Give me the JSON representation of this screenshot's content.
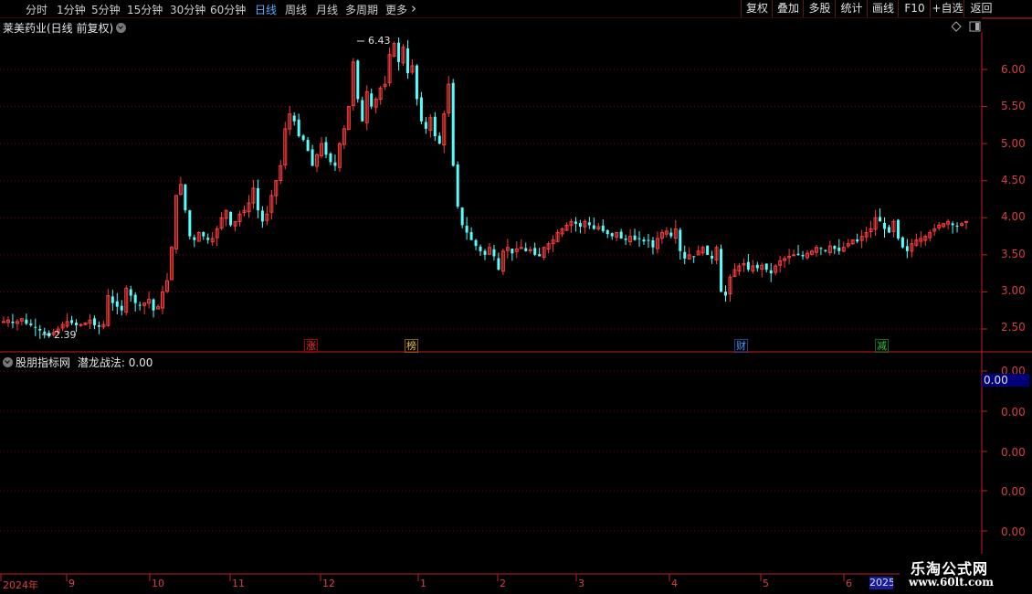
{
  "toolbar": {
    "periods": [
      "分时",
      "1分钟",
      "5分钟",
      "15分钟",
      "30分钟",
      "60分钟",
      "日线",
      "周线",
      "月线",
      "多周期",
      "更多"
    ],
    "active_period": "日线",
    "buttons": [
      "复权",
      "叠加",
      "多股",
      "统计",
      "画线",
      "F10",
      "+自选",
      "返回"
    ]
  },
  "stock": {
    "title": "莱美药业(日线 前复权)"
  },
  "price_axis": {
    "labels": [
      "6.00",
      "5.50",
      "5.00",
      "4.50",
      "4.00",
      "3.50",
      "3.00",
      "2.50"
    ]
  },
  "annotations": {
    "high": "6.43",
    "low": "2.39"
  },
  "markers": [
    {
      "text": "涨",
      "color": "#ff3030"
    },
    {
      "text": "榜",
      "color": "#e8c030"
    },
    {
      "text": "财",
      "color": "#40a0ff"
    },
    {
      "text": "减",
      "color": "#30d030"
    }
  ],
  "indicator": {
    "name": "股朋指标网",
    "line_label": "潜龙战法: 0.00",
    "axis_labels": [
      "0.00",
      "0.00",
      "0.00",
      "0.00",
      "0.00",
      "0.00"
    ],
    "current_value": "0.00"
  },
  "time_axis": {
    "labels": [
      "2024年",
      "9",
      "10",
      "11",
      "12",
      "1",
      "2",
      "3",
      "4",
      "5",
      "6"
    ],
    "highlight_label": "2025"
  },
  "watermark": {
    "line1": "乐淘公式网",
    "line2": "www.60lt.com"
  },
  "colors": {
    "up": "#ff3c3c",
    "down": "#54ffff",
    "grid": "#7a0000",
    "axis": "#c02020"
  },
  "chart_data": {
    "type": "candlestick",
    "title": "莱美药业(日线 前复权)",
    "ylim": [
      2.3,
      6.6
    ],
    "high": 6.43,
    "low": 2.39,
    "closes": [
      2.6,
      2.62,
      2.58,
      2.6,
      2.64,
      2.57,
      2.55,
      2.52,
      2.48,
      2.44,
      2.4,
      2.45,
      2.5,
      2.56,
      2.6,
      2.58,
      2.55,
      2.56,
      2.58,
      2.62,
      2.55,
      2.53,
      2.56,
      2.95,
      2.85,
      2.8,
      2.75,
      3.05,
      2.95,
      2.85,
      2.82,
      2.85,
      2.9,
      2.75,
      2.8,
      3.0,
      3.15,
      3.6,
      4.3,
      4.45,
      4.1,
      3.75,
      3.7,
      3.8,
      3.75,
      3.7,
      3.72,
      3.85,
      4.0,
      4.1,
      3.9,
      3.95,
      4.05,
      4.1,
      4.2,
      4.4,
      4.1,
      3.95,
      4.05,
      4.3,
      4.5,
      4.7,
      5.2,
      5.4,
      5.3,
      5.1,
      5.05,
      4.9,
      4.7,
      4.85,
      5.0,
      4.85,
      4.75,
      4.7,
      5.0,
      5.2,
      5.5,
      6.1,
      5.6,
      5.3,
      5.7,
      5.5,
      5.6,
      5.75,
      5.8,
      6.2,
      6.35,
      6.1,
      6.3,
      5.95,
      6.05,
      5.6,
      5.3,
      5.2,
      5.35,
      5.1,
      5.0,
      5.4,
      5.8,
      4.7,
      4.15,
      3.9,
      3.8,
      3.7,
      3.62,
      3.55,
      3.5,
      3.6,
      3.48,
      3.3,
      3.55,
      3.6,
      3.52,
      3.58,
      3.6,
      3.55,
      3.57,
      3.5,
      3.48,
      3.6,
      3.65,
      3.7,
      3.8,
      3.85,
      3.9,
      3.95,
      3.92,
      3.88,
      3.95,
      3.9,
      3.85,
      3.88,
      3.82,
      3.78,
      3.75,
      3.8,
      3.72,
      3.7,
      3.75,
      3.7,
      3.72,
      3.68,
      3.7,
      3.6,
      3.72,
      3.8,
      3.82,
      3.75,
      3.85,
      3.55,
      3.45,
      3.5,
      3.48,
      3.55,
      3.6,
      3.5,
      3.45,
      3.6,
      3.0,
      2.95,
      3.2,
      3.3,
      3.35,
      3.38,
      3.3,
      3.35,
      3.32,
      3.36,
      3.3,
      3.25,
      3.35,
      3.42,
      3.45,
      3.48,
      3.5,
      3.5,
      3.48,
      3.52,
      3.55,
      3.6,
      3.58,
      3.55,
      3.62,
      3.58,
      3.55,
      3.6,
      3.65,
      3.7,
      3.68,
      3.75,
      3.8,
      3.85,
      4.0,
      3.95,
      3.85,
      3.8,
      3.95,
      3.72,
      3.6,
      3.55,
      3.65,
      3.7,
      3.72,
      3.75,
      3.8,
      3.85,
      3.9,
      3.92,
      3.95,
      3.9,
      3.88,
      3.92,
      3.95
    ]
  }
}
